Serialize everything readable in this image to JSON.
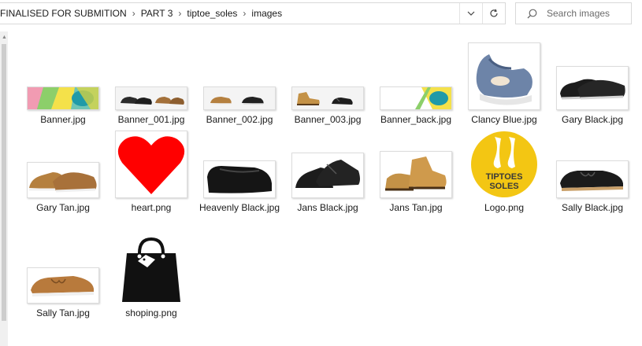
{
  "address": {
    "crumbs": [
      "FINALISED FOR SUBMITION",
      "PART 3",
      "tiptoe_soles",
      "images"
    ],
    "dropdown_icon": "chevron-down-icon",
    "refresh_icon": "refresh-icon"
  },
  "search": {
    "placeholder": "Search images",
    "icon": "search-icon"
  },
  "files": [
    {
      "name": "Banner.jpg"
    },
    {
      "name": "Banner_001.jpg"
    },
    {
      "name": "Banner_002.jpg"
    },
    {
      "name": "Banner_003.jpg"
    },
    {
      "name": "Banner_back.jpg"
    },
    {
      "name": "Clancy Blue.jpg"
    },
    {
      "name": "Gary Black.jpg"
    },
    {
      "name": "Gary Tan.jpg"
    },
    {
      "name": "heart.png"
    },
    {
      "name": "Heavenly Black.jpg"
    },
    {
      "name": "Jans Black.jpg"
    },
    {
      "name": "Jans Tan.jpg"
    },
    {
      "name": "Logo.png",
      "logo_text": [
        "TIPTOES",
        "SOLES"
      ]
    },
    {
      "name": "Sally Black.jpg"
    },
    {
      "name": "Sally Tan.jpg"
    },
    {
      "name": "shoping.png"
    }
  ],
  "colors": {
    "heart": "#ff0000",
    "logo_bg": "#f3c613",
    "tan": "#b5803f",
    "black_shoe": "#1e1e1e",
    "blue_sandal": "#6d84a8"
  }
}
